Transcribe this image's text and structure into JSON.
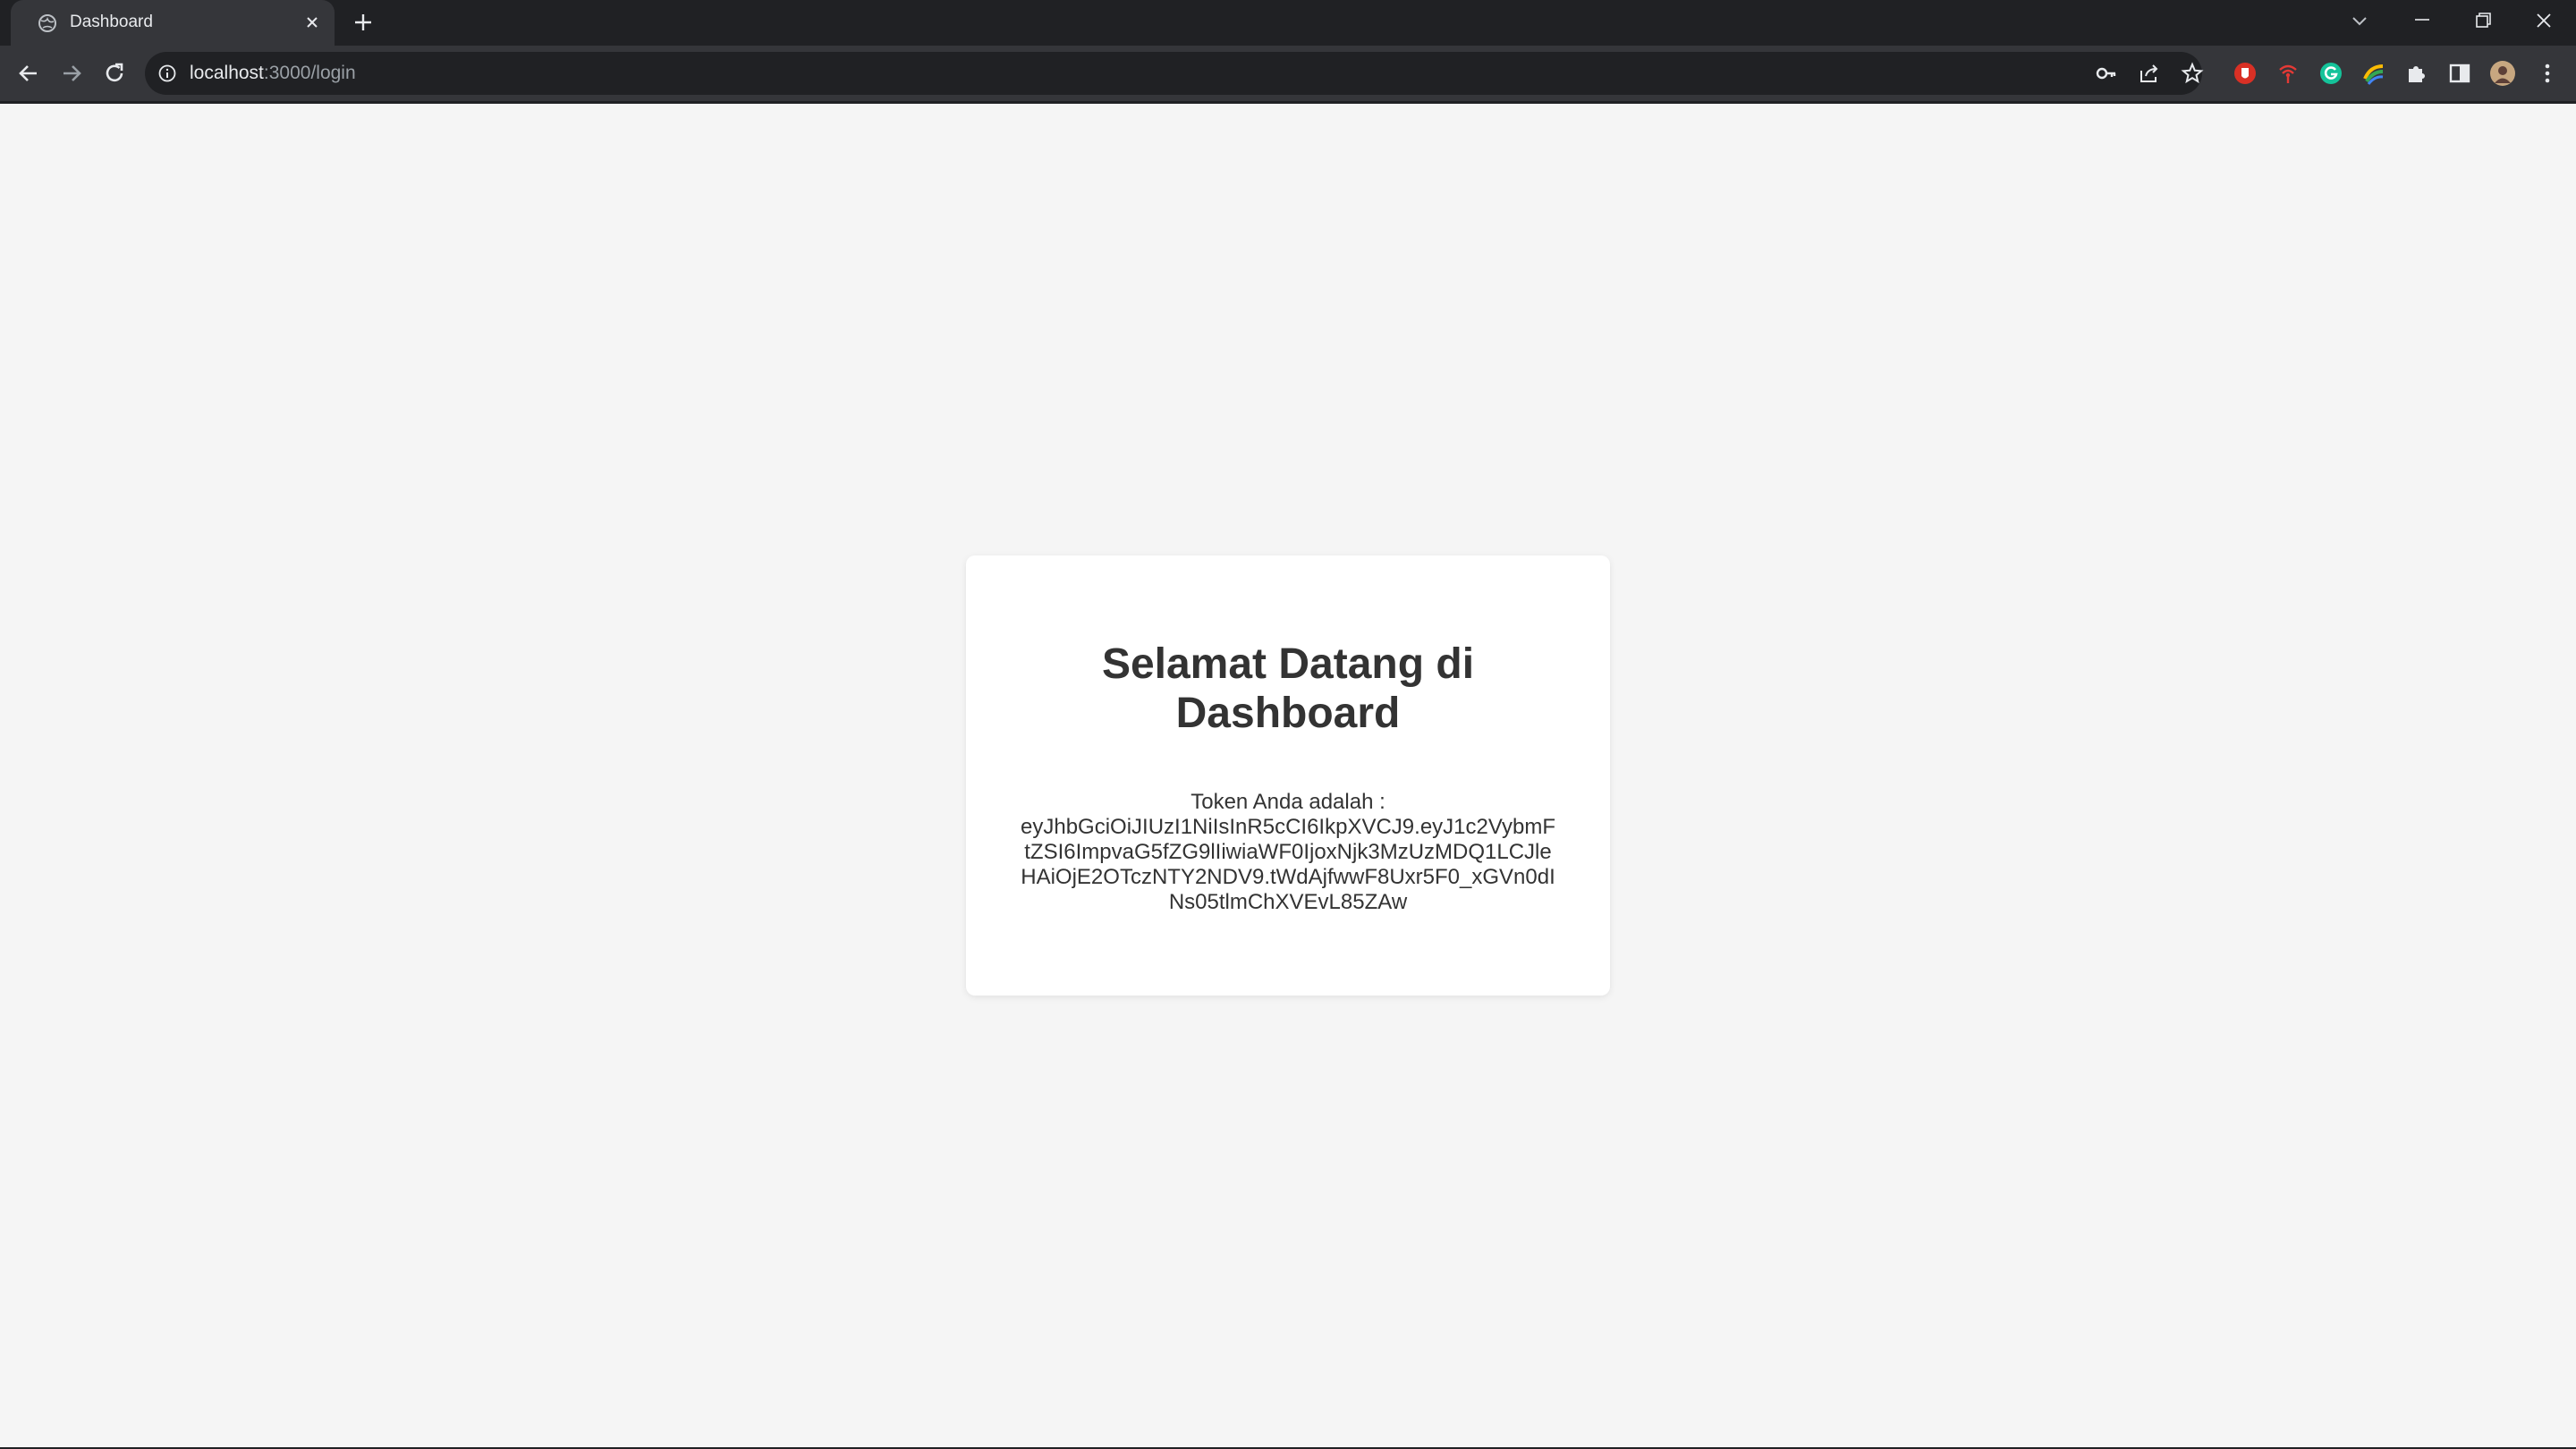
{
  "browser": {
    "tab": {
      "title": "Dashboard",
      "favicon": "globe-icon"
    },
    "address_bar": {
      "host": "localhost",
      "rest": ":3000/login"
    },
    "toolbar_icons": [
      "back-icon",
      "forward-icon",
      "reload-icon",
      "site-info-icon",
      "key-icon",
      "share-icon",
      "bookmark-star-icon"
    ],
    "extensions": [
      "red-shield-extension-icon",
      "red-signal-extension-icon",
      "grammarly-icon",
      "color-picker-extension-icon",
      "puzzle-extensions-icon",
      "side-panel-icon",
      "profile-avatar",
      "menu-dots-icon"
    ]
  },
  "page": {
    "title": "Selamat Datang di Dashboard",
    "token_label": "Token Anda adalah :",
    "token": "eyJhbGciOiJIUzI1NiIsInR5cCI6IkpXVCJ9.eyJ1c2VybmFtZSI6ImpvaG5fZG9lIiwiaWF0IjoxNjk3MzUzMDQ1LCJleHAiOjE2OTczNTY2NDV9.tWdAjfwwF8Uxr5F0_xGVn0dINs05tlmChXVEvL85ZAw"
  },
  "colors": {
    "chrome_dark": "#202124",
    "chrome_toolbar": "#35363a",
    "page_bg": "#f5f5f5",
    "card_bg": "#ffffff",
    "text": "#333333"
  }
}
